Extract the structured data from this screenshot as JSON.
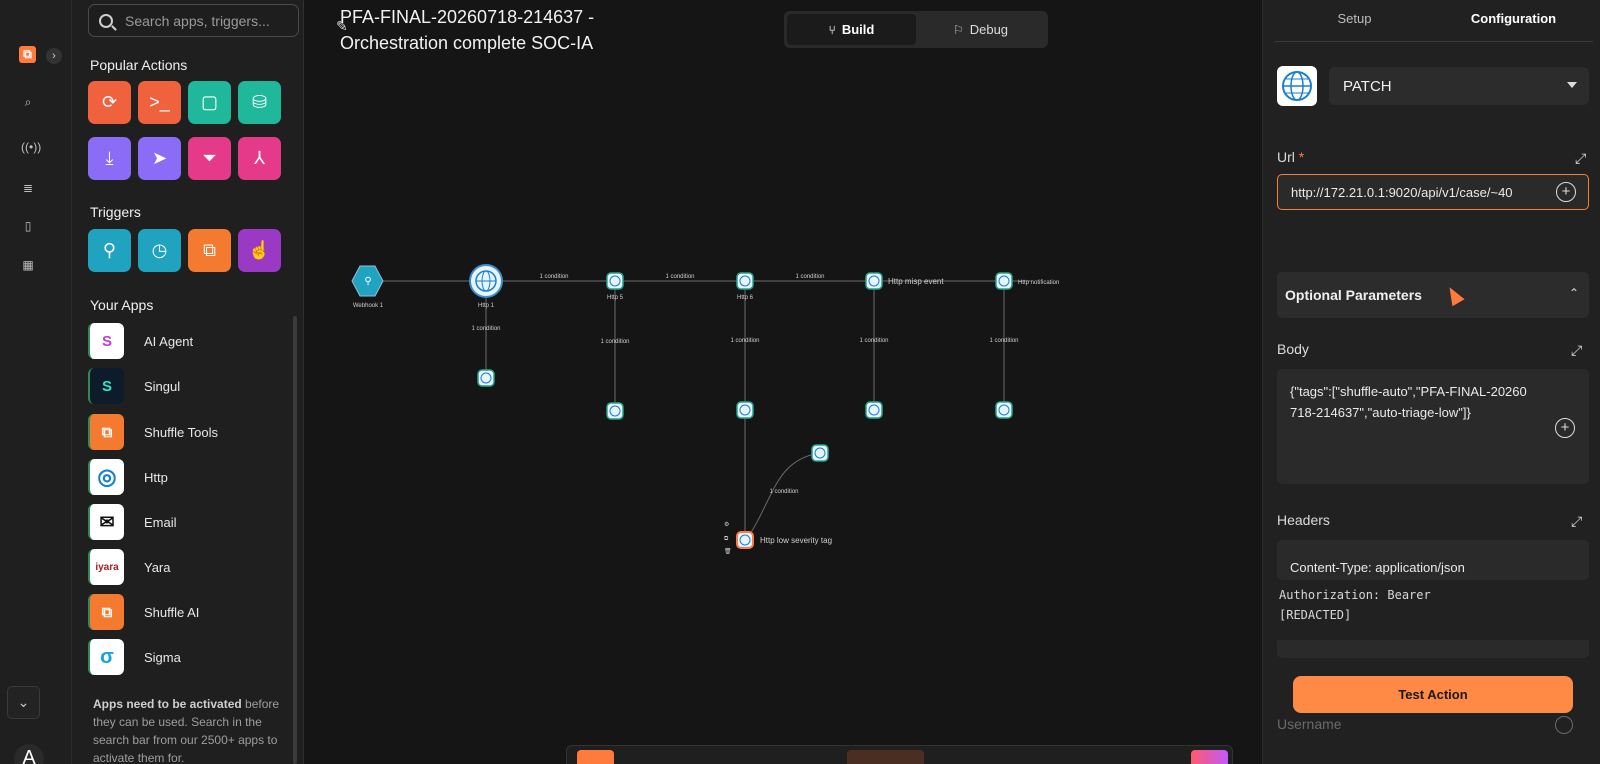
{
  "search": {
    "placeholder": "Search apps, triggers..."
  },
  "palette": {
    "popular_title": "Popular Actions",
    "triggers_title": "Triggers",
    "apps_title": "Your Apps",
    "apps": [
      {
        "label": "AI Agent",
        "glyph": "S"
      },
      {
        "label": "Singul",
        "glyph": "S"
      },
      {
        "label": "Shuffle Tools",
        "glyph": "⧉"
      },
      {
        "label": "Http",
        "glyph": "◎"
      },
      {
        "label": "Email",
        "glyph": "✉"
      },
      {
        "label": "Yara",
        "glyph": "iyara"
      },
      {
        "label": "Shuffle AI",
        "glyph": "⧉"
      },
      {
        "label": "Sigma",
        "glyph": "σ"
      }
    ],
    "note_bold": "Apps need to be activated",
    "note_rest": " before they can be used. Search in the search bar from our 2500+ apps to activate them for."
  },
  "workflow": {
    "title": "PFA-FINAL-20260718-214637 - Orchestration complete SOC-IA",
    "tab_build": "Build",
    "tab_debug": "Debug"
  },
  "flow": {
    "nodes": {
      "webhook": "Webhook 1",
      "http1": "Http 1",
      "http5": "Http 5",
      "http6": "Http 6",
      "misp": "Http misp event",
      "notif": "Http notification",
      "lowsev": "Http low severity tag"
    },
    "edge_label": "1 condition"
  },
  "panel": {
    "tab_setup": "Setup",
    "tab_configuration": "Configuration",
    "method": "PATCH",
    "url_label": "Url",
    "url_required": "*",
    "url_value": "http://172.21.0.1:9020/api/v1/case/~40",
    "optional_title": "Optional Parameters",
    "body_label": "Body",
    "body_value": "{\"tags\":[\"shuffle-auto\",\"PFA-FINAL-20260718-214637\",\"auto-triage-low\"]}",
    "headers_label": "Headers",
    "header_line1": "Content-Type: application/json",
    "header_line2": "Authorization: Bearer",
    "header_line3": "[REDACTED]",
    "test_button": "Test Action",
    "faded_label": "Username"
  },
  "rail": {
    "avatar": "A"
  }
}
